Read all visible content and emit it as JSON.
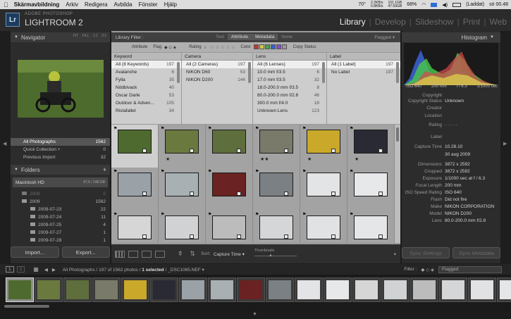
{
  "menubar": {
    "app": "Skärmavbildning",
    "menus": [
      "Arkiv",
      "Redigera",
      "Avbilda",
      "Fönster",
      "Hjälp"
    ],
    "temp": "70°",
    "net1": "2.2KB/s",
    "net2": "0.8KB/s",
    "mem1": "101.1GB",
    "mem2": "47.59GB",
    "battery_pct": "68%",
    "battery_status": "(Laddat)",
    "clock": "sö 00.48"
  },
  "topbar": {
    "logo": "Lr",
    "brand_small": "ADOBE PHOTOSHOP",
    "brand_large": "LIGHTROOM 2",
    "modules": [
      "Library",
      "Develop",
      "Slideshow",
      "Print",
      "Web"
    ]
  },
  "navigator": {
    "title": "Navigator",
    "options": [
      "FIT",
      "FILL",
      "1:1",
      "3:1"
    ]
  },
  "catalog": {
    "items": [
      {
        "label": "All Photographs",
        "count": "1562"
      },
      {
        "label": "Quick Collection +",
        "count": "0"
      },
      {
        "label": "Previous Import",
        "count": "32"
      }
    ]
  },
  "folders": {
    "title": "Folders",
    "volume": "Macintosh HD",
    "volume_size": "47,5 / 148 GB",
    "items": [
      {
        "label": "2008",
        "count": "0"
      },
      {
        "label": "2009",
        "count": "1562"
      },
      {
        "label": "2009-07-23",
        "count": "22"
      },
      {
        "label": "2009-07-24",
        "count": "11"
      },
      {
        "label": "2009-07-25",
        "count": "4"
      },
      {
        "label": "2009-07-27",
        "count": "1"
      },
      {
        "label": "2009-07-28",
        "count": "1"
      }
    ]
  },
  "left_buttons": {
    "import": "Import...",
    "export": "Export..."
  },
  "library_filter": {
    "label": "Library Filter :",
    "tabs": [
      "Text",
      "Attribute",
      "Metadata",
      "None"
    ],
    "preset": "Flagged"
  },
  "attribute_bar": {
    "attribute": "Attribute",
    "flag": "Flag",
    "rating": "Rating",
    "color": "Color",
    "copy_status": "Copy Status",
    "swatches": [
      "#cc3333",
      "#d6c64a",
      "#4aa34a",
      "#3a5fcc",
      "#8a4acc",
      "#9a9a9a"
    ]
  },
  "metadata": {
    "columns": [
      {
        "header": "Keyword",
        "rows": [
          {
            "label": "All (8 Keywords)",
            "count": "197"
          },
          {
            "label": "Avalanche",
            "count": "6"
          },
          {
            "label": "Fylla",
            "count": "35"
          },
          {
            "label": "Nödbivack",
            "count": "40"
          },
          {
            "label": "Oscar Darle",
            "count": "53"
          },
          {
            "label": "Outdoor & Adven...",
            "count": "105"
          },
          {
            "label": "Ristafallet",
            "count": "34"
          }
        ]
      },
      {
        "header": "Camera",
        "rows": [
          {
            "label": "All (2 Cameras)",
            "count": "197"
          },
          {
            "label": "NIKON D60",
            "count": "53"
          },
          {
            "label": "NIKON D200",
            "count": "144"
          }
        ]
      },
      {
        "header": "Lens",
        "rows": [
          {
            "label": "All (6 Lenses)",
            "count": "197"
          },
          {
            "label": "10.0 mm f/3.5",
            "count": "6"
          },
          {
            "label": "17.0 mm f/3.5",
            "count": "32"
          },
          {
            "label": "18.0-200.0 mm f/3.5",
            "count": "8"
          },
          {
            "label": "80.0-200.0 mm f/2.8",
            "count": "46"
          },
          {
            "label": "300.0 mm f/4.0",
            "count": "18"
          },
          {
            "label": "Unknown Lens",
            "count": "123"
          }
        ]
      },
      {
        "header": "Label",
        "rows": [
          {
            "label": "All (1 Label)",
            "count": "197"
          },
          {
            "label": "No Label",
            "count": "197"
          }
        ]
      }
    ]
  },
  "toolbar": {
    "sort_label": "Sort:",
    "sort_value": "Capture Time",
    "thumbnails": "Thumbnails"
  },
  "histogram": {
    "title": "Histogram",
    "iso": "ISO 640",
    "focal": "200 mm",
    "aperture": "f / 6.3",
    "shutter": "1/1000 sec"
  },
  "metadata_panel": {
    "rows": [
      {
        "k": "Copyright",
        "v": ""
      },
      {
        "k": "Copyright Status",
        "v": "Unknown"
      },
      {
        "k": "Creator",
        "v": ""
      },
      {
        "k": "Location",
        "v": ""
      },
      {
        "k": "Rating",
        "v": "·  ·  ·  ·  ·"
      },
      {
        "k": "Label",
        "v": ""
      },
      {
        "k": "Capture Time",
        "v": "10.28.10"
      },
      {
        "k": "",
        "v": "30 aug 2009"
      },
      {
        "k": "Dimensions",
        "v": "3872 x 2592"
      },
      {
        "k": "Cropped",
        "v": "3872 x 2592"
      },
      {
        "k": "Exposure",
        "v": "1/1000 sec at f / 6.3"
      },
      {
        "k": "Focal Length",
        "v": "200 mm"
      },
      {
        "k": "ISO Speed Rating",
        "v": "ISO 640"
      },
      {
        "k": "Flash",
        "v": "Did not fire"
      },
      {
        "k": "Make",
        "v": "NIKON CORPORATION"
      },
      {
        "k": "Model",
        "v": "NIKON D200"
      },
      {
        "k": "Lens",
        "v": "80.0-200.0 mm f/2.8"
      }
    ]
  },
  "sync": {
    "settings": "Sync Settings",
    "metadata": "Sync Metadata"
  },
  "filmstrip_bar": {
    "screen1": "1",
    "screen2": "2",
    "path": "All Photographs / 197 of 1562 photos / ",
    "selected": "1 selected",
    "file": " / _DSC1065.NEF",
    "filter_label": "Filter :",
    "filter_value": "Flagged"
  },
  "grid": {
    "cells": [
      {
        "color": "#4e6a2e",
        "stars": "",
        "sel": true
      },
      {
        "color": "#6a7a3e",
        "stars": "★",
        "sel": false
      },
      {
        "color": "#5e6e3c",
        "stars": "",
        "sel": false
      },
      {
        "color": "#7a7a6a",
        "stars": "★★",
        "sel": false
      },
      {
        "color": "#caa82a",
        "stars": "★",
        "sel": false
      },
      {
        "color": "#2a2a34",
        "stars": "★",
        "sel": false
      },
      {
        "color": "#9aa2a8",
        "stars": "",
        "sel": false
      },
      {
        "color": "#a8b0b4",
        "stars": "",
        "sel": false
      },
      {
        "color": "#6a2222",
        "stars": "",
        "sel": false
      },
      {
        "color": "#7a8084",
        "stars": "",
        "sel": false
      },
      {
        "color": "#e2e4e6",
        "stars": "",
        "sel": false
      },
      {
        "color": "#e6e8ea",
        "stars": "",
        "sel": false
      },
      {
        "color": "#d6d6d6",
        "stars": "",
        "sel": false
      },
      {
        "color": "#d0d2d4",
        "stars": "",
        "sel": false
      },
      {
        "color": "#bcbcbc",
        "stars": "",
        "sel": false
      },
      {
        "color": "#d4d6d8",
        "stars": "",
        "sel": false
      },
      {
        "color": "#e0e2e4",
        "stars": "",
        "sel": false
      },
      {
        "color": "#e4e6e8",
        "stars": "",
        "sel": false
      }
    ]
  },
  "filmstrip": {
    "thumbs": [
      "#4e6a2e",
      "#6a7a3e",
      "#5e6e3c",
      "#7a7a6a",
      "#caa82a",
      "#2a2a34",
      "#9aa2a8",
      "#a8b0b4",
      "#6a2222",
      "#7a8084",
      "#e2e4e6",
      "#e6e8ea",
      "#d6d6d6",
      "#d0d2d4",
      "#bcbcbc",
      "#d4d6d8",
      "#e0e2e4",
      "#e4e6e8"
    ]
  }
}
